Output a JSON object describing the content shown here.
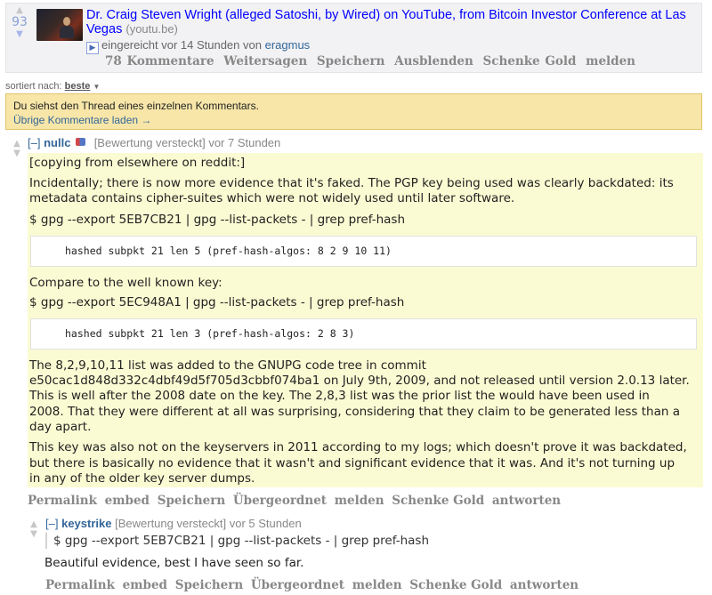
{
  "post": {
    "score": "93",
    "upvote_glyph": "▲",
    "downvote_glyph": "▼",
    "title": "Dr. Craig Steven Wright (alleged Satoshi, by Wired) on YouTube, from Bitcoin Investor Conference at Las Vegas",
    "domain": "(youtu.be)",
    "expando_glyph": "▶",
    "submitted_prefix": "eingereicht vor 14 Stunden von",
    "author": "eragmus",
    "buttons": [
      "78 Kommentare",
      "Weitersagen",
      "Speichern",
      "Ausblenden",
      "Schenke Gold",
      "melden"
    ]
  },
  "sort": {
    "label": "sortiert nach:",
    "value": "beste",
    "caret": "▼"
  },
  "notice": {
    "message": "Du siehst den Thread eines einzelnen Kommentars.",
    "link": "Übrige Kommentare laden →"
  },
  "comment": {
    "expand": "[–]",
    "author": "nullc",
    "score_hidden": "[Bewertung versteckt]",
    "time": "vor 7 Stunden",
    "paragraphs": {
      "p1": "[copying from elsewhere on reddit:]",
      "p2_line1": "Incidentally; there is now more evidence that it's faked. The PGP key being used was clearly backdated: its",
      "p2_line2": "metadata contains cipher-suites which were not widely used until later software.",
      "cmd1": "$ gpg --export 5EB7CB21 | gpg --list-packets - | grep pref-hash",
      "code1": "hashed subpkt 21 len 5 (pref-hash-algos: 8 2 9 10 11)",
      "p3": "Compare to the well known key:",
      "cmd2": "$ gpg --export 5EC948A1 | gpg --list-packets - | grep pref-hash",
      "code2": "hashed subpkt 21 len 3 (pref-hash-algos: 2 8 3)",
      "p4_line1": "The 8,2,9,10,11 list was added to the GNUPG code tree in commit",
      "p4_line2": "e50cac1d848d332c4dbf49d5f705d3cbbf074ba1 on July 9th, 2009, and not released until version 2.0.13 later.",
      "p4_line3": "This is well after the 2008 date on the key. The 2,8,3 list was the prior list the would have been used in",
      "p4_line4": "2008. That they were different at all was surprising, considering that they claim to be generated less than a",
      "p4_line5": "day apart.",
      "p5_line1": "This key was also not on the keyservers in 2011 according to my logs; which doesn't prove it was backdated,",
      "p5_line2": "but there is basically no evidence that it wasn't and significant evidence that it was. And it's not turning up",
      "p5_line3": "in any of the older key server dumps."
    },
    "buttons": [
      "Permalink",
      "embed",
      "Speichern",
      "Übergeordnet",
      "melden",
      "Schenke Gold",
      "antworten"
    ]
  },
  "reply": {
    "expand": "[–]",
    "author": "keystrike",
    "score_hidden": "[Bewertung versteckt]",
    "time": "vor 5 Stunden",
    "quote": "$ gpg --export 5EB7CB21 | gpg --list-packets - | grep pref-hash",
    "text": "Beautiful evidence, best I have seen so far.",
    "buttons": [
      "Permalink",
      "embed",
      "Speichern",
      "Übergeordnet",
      "melden",
      "Schenke Gold",
      "antworten"
    ]
  },
  "colors": {
    "link": "#0000ff",
    "author": "#336699",
    "highlight": "#fbfbd3",
    "notice_bg": "#f7e6a8",
    "score": "#8aa1d8"
  },
  "icons": {
    "upvote": "upvote-arrow-icon",
    "downvote": "downvote-arrow-icon",
    "expando": "video-expando-icon",
    "flair": "flair-icon"
  }
}
